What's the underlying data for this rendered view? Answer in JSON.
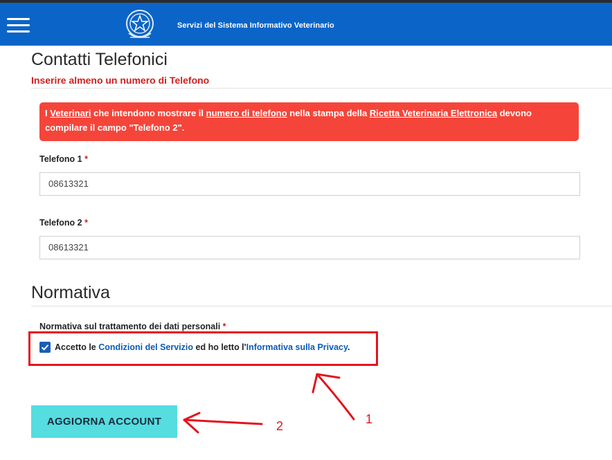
{
  "header": {
    "title": "Servizi del Sistema Informativo Veterinario",
    "menu_icon": "hamburger-menu-icon",
    "emblem_icon": "italian-republic-emblem-icon",
    "background_color": "#0b65c8"
  },
  "contacts": {
    "title": "Contatti Telefonici",
    "required_note": "Inserire almeno un numero di Telefono",
    "alert": {
      "t1": "I ",
      "link1": "Veterinari",
      "t2": " che intendono mostrare il ",
      "link2": "numero di telefono",
      "t3": " nella stampa della ",
      "link3": "Ricetta Veterinaria Elettronica",
      "t4": " devono compilare il campo \"Telefono 2\".",
      "background_color": "#f5453a"
    },
    "phone1": {
      "label": "Telefono 1",
      "required_mark": "*",
      "value": "08613321"
    },
    "phone2": {
      "label": "Telefono 2",
      "required_mark": "*",
      "value": "08613321"
    }
  },
  "regulation": {
    "title": "Normativa",
    "privacy_label": "Normativa sul trattamento dei dati personali",
    "required_mark": "*",
    "consent": {
      "checked": true,
      "prefix": "Accetto le ",
      "terms_link": "Condizioni del Servizio",
      "middle": " ed ho letto l'",
      "privacy_link": "Informativa sulla Privacy",
      "suffix": "."
    }
  },
  "submit_button": {
    "label": "AGGIORNA ACCOUNT",
    "color": "#55dde0"
  },
  "annotations": {
    "label_1": "1",
    "label_2": "2",
    "color": "#e4141c"
  }
}
